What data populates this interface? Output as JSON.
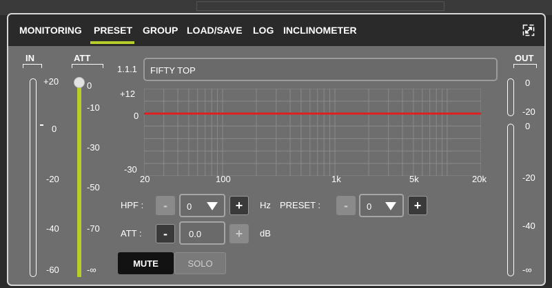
{
  "tabs": [
    {
      "label": "MONITORING"
    },
    {
      "label": "PRESET"
    },
    {
      "label": "GROUP"
    },
    {
      "label": "LOAD/SAVE"
    },
    {
      "label": "LOG"
    },
    {
      "label": "INCLINOMETER"
    }
  ],
  "active_tab": "PRESET",
  "accent_color": "#b8cc2a",
  "curve_color": "#e02020",
  "in_meter": {
    "title": "IN",
    "scale": [
      "+20",
      "0",
      "-20",
      "-40",
      "-60"
    ]
  },
  "att_fader": {
    "title": "ATT",
    "scale": [
      "0",
      "-10",
      "-30",
      "-50",
      "-70",
      "-∞"
    ],
    "position": "top"
  },
  "out_meter": {
    "title": "OUT",
    "scale_upper": [
      "0",
      "-20"
    ],
    "scale_lower": [
      "0",
      "-20",
      "-40",
      "-∞"
    ]
  },
  "channel": {
    "id": "1.1.1",
    "name": "FIFTY TOP"
  },
  "eq_graph": {
    "y_ticks": [
      "+12",
      "0",
      "-30"
    ],
    "x_ticks": [
      "20",
      "100",
      "1k",
      "5k",
      "20k"
    ],
    "gain_db": 0
  },
  "hpf": {
    "label": "HPF :",
    "minus": "-",
    "plus": "+",
    "value": "0",
    "unit": "Hz"
  },
  "preset": {
    "label": "PRESET :",
    "minus": "-",
    "plus": "+",
    "value": "0"
  },
  "att": {
    "label": "ATT :",
    "minus": "-",
    "plus": "+",
    "value": "0.0",
    "unit": "dB"
  },
  "buttons": {
    "mute": "MUTE",
    "solo": "SOLO"
  },
  "icons": {
    "expand": "expand-icon",
    "dropdown": "caret-down-icon"
  }
}
